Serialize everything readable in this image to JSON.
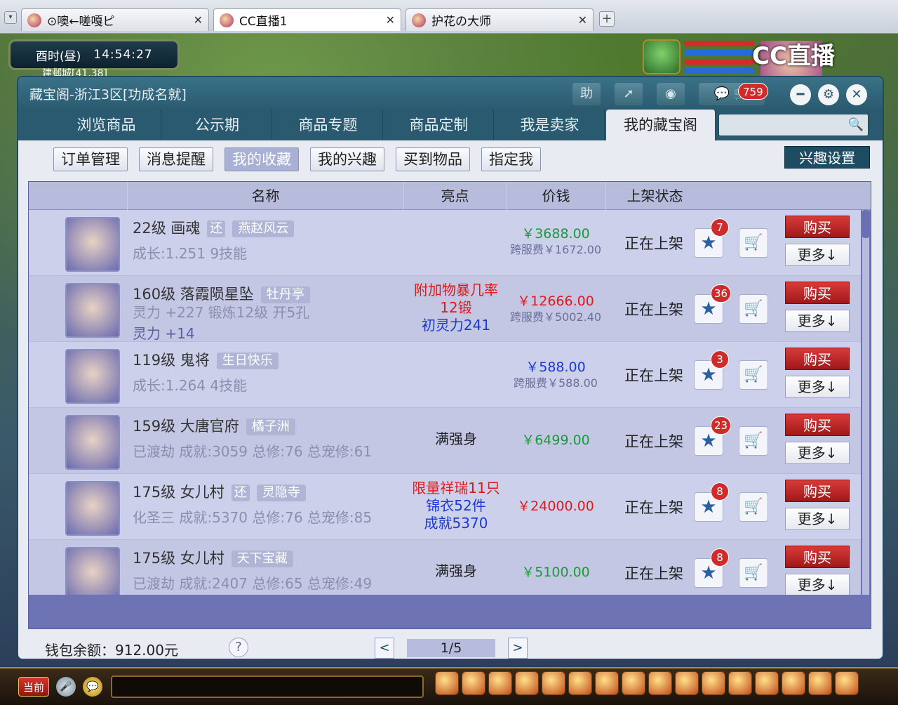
{
  "browser": {
    "tabs": [
      {
        "title": "⊙噢←嗟嘎ピ",
        "active": false
      },
      {
        "title": "CC直播1",
        "active": true
      },
      {
        "title": "护花の大师",
        "active": false
      }
    ],
    "new_tab": "+"
  },
  "game": {
    "time_label": "酉时(昼)",
    "time": "14:54:27",
    "location": "建邺城[41,38]",
    "cc_logo": "CC直播",
    "current_label": "当前"
  },
  "window": {
    "title": "藏宝阁-浙江3区[功成名就]",
    "toolbar": {
      "help_label": "助",
      "share_icon": "share-icon",
      "stop_icon": "stop-icon",
      "chat_badge": "759"
    },
    "nav_tabs": [
      "浏览商品",
      "公示期",
      "商品专题",
      "商品定制",
      "我是卖家",
      "我的藏宝阁"
    ],
    "active_nav": "我的藏宝阁",
    "search": {
      "placeholder": ""
    },
    "sub_tabs": [
      "订单管理",
      "消息提醒",
      "我的收藏",
      "我的兴趣",
      "买到物品",
      "指定我"
    ],
    "active_sub": "我的收藏",
    "interest_btn": "兴趣设置"
  },
  "table": {
    "headers": [
      "名称",
      "亮点",
      "价钱",
      "上架状态"
    ],
    "buy_label": "购买",
    "more_label": "更多↓",
    "rows": [
      {
        "name": "22级  画魂",
        "tags": [
          "还",
          "燕赵风云"
        ],
        "sub": "成长:1.251  9技能",
        "sub2": "",
        "highlight": [],
        "price": "￥3688.00",
        "price_color": "green",
        "cross": "跨服费￥1672.00",
        "status": "正在上架",
        "fav": "7"
      },
      {
        "name": "160级  落霞陨星坠",
        "tags": [
          "牡丹亭"
        ],
        "sub": "灵力 +227  锻炼12级  开5孔",
        "sub2": "灵力 +14",
        "highlight": [
          {
            "text": "附加物暴几率",
            "color": "red"
          },
          {
            "text": "12锻",
            "color": "red"
          },
          {
            "text": "初灵力241",
            "color": "blue"
          }
        ],
        "price": "￥12666.00",
        "price_color": "red",
        "cross": "跨服费￥5002.40",
        "status": "正在上架",
        "fav": "36"
      },
      {
        "name": "119级  鬼将",
        "tags": [
          "生日快乐"
        ],
        "sub": "成长:1.264  4技能",
        "sub2": "",
        "highlight": [],
        "price": "￥588.00",
        "price_color": "blue",
        "cross": "跨服费￥588.00",
        "status": "正在上架",
        "fav": "3"
      },
      {
        "name": "159级  大唐官府",
        "tags": [
          "橘子洲"
        ],
        "sub": "已渡劫  成就:3059  总修:76  总宠修:61",
        "sub2": "",
        "highlight": [
          {
            "text": "满强身",
            "color": "dark"
          }
        ],
        "price": "￥6499.00",
        "price_color": "green",
        "cross": "",
        "status": "正在上架",
        "fav": "23"
      },
      {
        "name": "175级  女儿村",
        "tags": [
          "还",
          "灵隐寺"
        ],
        "sub": "化圣三  成就:5370  总修:76  总宠修:85",
        "sub2": "",
        "highlight": [
          {
            "text": "限量祥瑞11只",
            "color": "red"
          },
          {
            "text": "锦衣52件",
            "color": "blue"
          },
          {
            "text": "成就5370",
            "color": "blue"
          }
        ],
        "price": "￥24000.00",
        "price_color": "red",
        "cross": "",
        "status": "正在上架",
        "fav": "8"
      },
      {
        "name": "175级  女儿村",
        "tags": [
          "天下宝藏"
        ],
        "sub": "已渡劫  成就:2407  总修:65  总宠修:49",
        "sub2": "",
        "highlight": [
          {
            "text": "满强身",
            "color": "dark"
          }
        ],
        "price": "￥5100.00",
        "price_color": "green",
        "cross": "",
        "status": "正在上架",
        "fav": "8"
      }
    ]
  },
  "footer": {
    "wallet": "钱包余额：912.00元",
    "help": "?",
    "prev": "<",
    "page": "1/5",
    "next": ">"
  }
}
